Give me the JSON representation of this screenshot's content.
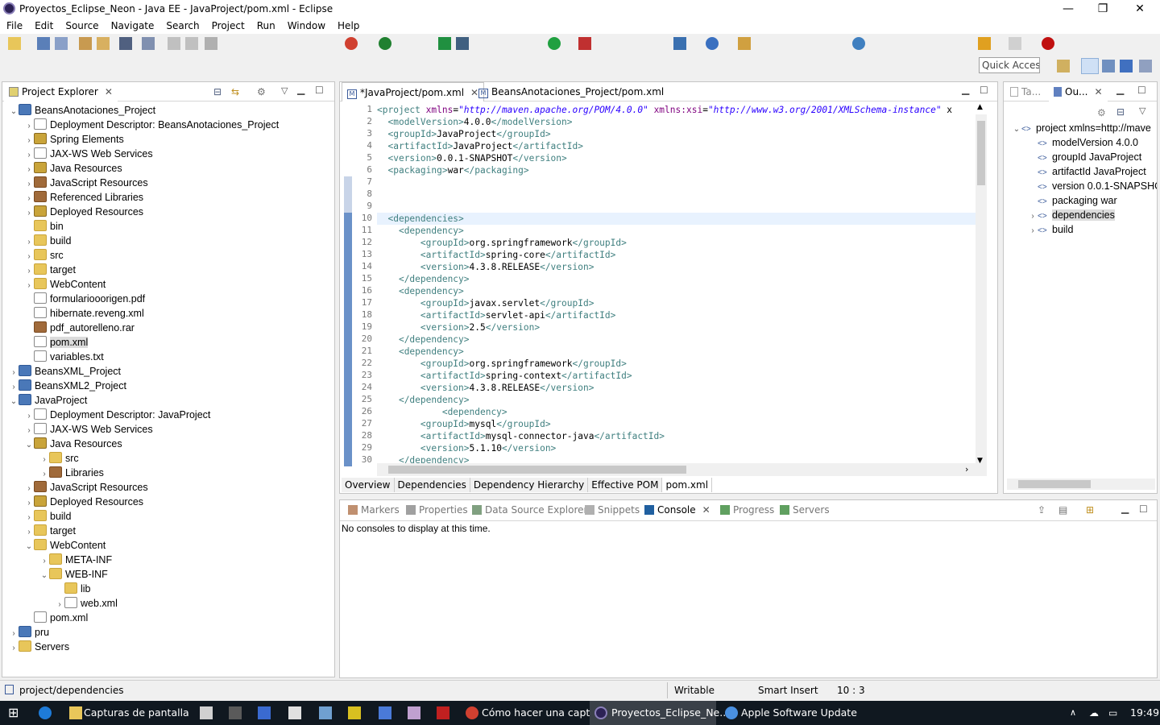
{
  "window": {
    "title": "Proyectos_Eclipse_Neon - Java EE - JavaProject/pom.xml - Eclipse",
    "minimize": "—",
    "restore": "❐",
    "close": "✕"
  },
  "menu": [
    "File",
    "Edit",
    "Source",
    "Navigate",
    "Search",
    "Project",
    "Run",
    "Window",
    "Help"
  ],
  "quick_access": "Quick Access",
  "explorer": {
    "tab": "Project Explorer",
    "items": [
      {
        "label": "BeansAnotaciones_Project",
        "level": 0,
        "exp": "open",
        "icon": "proj"
      },
      {
        "label": "Deployment Descriptor: BeansAnotaciones_Project",
        "level": 1,
        "exp": "closed",
        "icon": "file"
      },
      {
        "label": "Spring Elements",
        "level": 1,
        "exp": "closed",
        "icon": "jres"
      },
      {
        "label": "JAX-WS Web Services",
        "level": 1,
        "exp": "closed",
        "icon": "file"
      },
      {
        "label": "Java Resources",
        "level": 1,
        "exp": "closed",
        "icon": "jres"
      },
      {
        "label": "JavaScript Resources",
        "level": 1,
        "exp": "closed",
        "icon": "lib"
      },
      {
        "label": "Referenced Libraries",
        "level": 1,
        "exp": "closed",
        "icon": "lib"
      },
      {
        "label": "Deployed Resources",
        "level": 1,
        "exp": "closed",
        "icon": "jres"
      },
      {
        "label": "bin",
        "level": 1,
        "exp": "none",
        "icon": "folder"
      },
      {
        "label": "build",
        "level": 1,
        "exp": "closed",
        "icon": "folder"
      },
      {
        "label": "src",
        "level": 1,
        "exp": "closed",
        "icon": "folder"
      },
      {
        "label": "target",
        "level": 1,
        "exp": "closed",
        "icon": "folder"
      },
      {
        "label": "WebContent",
        "level": 1,
        "exp": "closed",
        "icon": "folder"
      },
      {
        "label": "formulariooorigen.pdf",
        "level": 1,
        "exp": "none",
        "icon": "file"
      },
      {
        "label": "hibernate.reveng.xml",
        "level": 1,
        "exp": "none",
        "icon": "file"
      },
      {
        "label": "pdf_autorelleno.rar",
        "level": 1,
        "exp": "none",
        "icon": "lib"
      },
      {
        "label": "pom.xml",
        "level": 1,
        "exp": "none",
        "icon": "file",
        "selected": true
      },
      {
        "label": "variables.txt",
        "level": 1,
        "exp": "none",
        "icon": "file"
      },
      {
        "label": "BeansXML_Project",
        "level": 0,
        "exp": "closed",
        "icon": "proj"
      },
      {
        "label": "BeansXML2_Project",
        "level": 0,
        "exp": "closed",
        "icon": "proj"
      },
      {
        "label": "JavaProject",
        "level": 0,
        "exp": "open",
        "icon": "proj"
      },
      {
        "label": "Deployment Descriptor: JavaProject",
        "level": 1,
        "exp": "closed",
        "icon": "file"
      },
      {
        "label": "JAX-WS Web Services",
        "level": 1,
        "exp": "closed",
        "icon": "file"
      },
      {
        "label": "Java Resources",
        "level": 1,
        "exp": "open",
        "icon": "jres"
      },
      {
        "label": "src",
        "level": 2,
        "exp": "closed",
        "icon": "folder"
      },
      {
        "label": "Libraries",
        "level": 2,
        "exp": "closed",
        "icon": "lib"
      },
      {
        "label": "JavaScript Resources",
        "level": 1,
        "exp": "closed",
        "icon": "lib"
      },
      {
        "label": "Deployed Resources",
        "level": 1,
        "exp": "closed",
        "icon": "jres"
      },
      {
        "label": "build",
        "level": 1,
        "exp": "closed",
        "icon": "folder"
      },
      {
        "label": "target",
        "level": 1,
        "exp": "closed",
        "icon": "folder"
      },
      {
        "label": "WebContent",
        "level": 1,
        "exp": "open",
        "icon": "folder"
      },
      {
        "label": "META-INF",
        "level": 2,
        "exp": "closed",
        "icon": "folder"
      },
      {
        "label": "WEB-INF",
        "level": 2,
        "exp": "open",
        "icon": "folder"
      },
      {
        "label": "lib",
        "level": 3,
        "exp": "none",
        "icon": "folder"
      },
      {
        "label": "web.xml",
        "level": 3,
        "exp": "closed",
        "icon": "file"
      },
      {
        "label": "pom.xml",
        "level": 1,
        "exp": "none",
        "icon": "file"
      },
      {
        "label": "pru",
        "level": 0,
        "exp": "closed",
        "icon": "proj"
      },
      {
        "label": "Servers",
        "level": 0,
        "exp": "closed",
        "icon": "folder"
      }
    ]
  },
  "editor": {
    "tabs": [
      "*JavaProject/pom.xml",
      "BeansAnotaciones_Project/pom.xml"
    ],
    "lines": [
      [
        [
          "tag",
          "<project "
        ],
        [
          "attr",
          "xmlns"
        ],
        [
          "txt",
          "="
        ],
        [
          "val",
          "\"http://maven.apache.org/POM/4.0.0\""
        ],
        [
          "txt",
          " "
        ],
        [
          "attr",
          "xmlns:xsi"
        ],
        [
          "txt",
          "="
        ],
        [
          "val",
          "\"http://www.w3.org/2001/XMLSchema-instance\""
        ],
        [
          "txt",
          " x"
        ]
      ],
      [
        [
          "txt",
          "  "
        ],
        [
          "tag",
          "<modelVersion>"
        ],
        [
          "txt",
          "4.0.0"
        ],
        [
          "tag",
          "</modelVersion>"
        ]
      ],
      [
        [
          "txt",
          "  "
        ],
        [
          "tag",
          "<groupId>"
        ],
        [
          "txt",
          "JavaProject"
        ],
        [
          "tag",
          "</groupId>"
        ]
      ],
      [
        [
          "txt",
          "  "
        ],
        [
          "tag",
          "<artifactId>"
        ],
        [
          "txt",
          "JavaProject"
        ],
        [
          "tag",
          "</artifactId>"
        ]
      ],
      [
        [
          "txt",
          "  "
        ],
        [
          "tag",
          "<version>"
        ],
        [
          "txt",
          "0.0.1-SNAPSHOT"
        ],
        [
          "tag",
          "</version>"
        ]
      ],
      [
        [
          "txt",
          "  "
        ],
        [
          "tag",
          "<packaging>"
        ],
        [
          "txt",
          "war"
        ],
        [
          "tag",
          "</packaging>"
        ]
      ],
      [],
      [],
      [],
      [
        [
          "txt",
          "  "
        ],
        [
          "tag",
          "<dependencies>"
        ]
      ],
      [
        [
          "txt",
          "    "
        ],
        [
          "tag",
          "<dependency>"
        ]
      ],
      [
        [
          "txt",
          "        "
        ],
        [
          "tag",
          "<groupId>"
        ],
        [
          "txt",
          "org.springframework"
        ],
        [
          "tag",
          "</groupId>"
        ]
      ],
      [
        [
          "txt",
          "        "
        ],
        [
          "tag",
          "<artifactId>"
        ],
        [
          "txt",
          "spring-core"
        ],
        [
          "tag",
          "</artifactId>"
        ]
      ],
      [
        [
          "txt",
          "        "
        ],
        [
          "tag",
          "<version>"
        ],
        [
          "txt",
          "4.3.8.RELEASE"
        ],
        [
          "tag",
          "</version>"
        ]
      ],
      [
        [
          "txt",
          "    "
        ],
        [
          "tag",
          "</dependency>"
        ]
      ],
      [
        [
          "txt",
          "    "
        ],
        [
          "tag",
          "<dependency>"
        ]
      ],
      [
        [
          "txt",
          "        "
        ],
        [
          "tag",
          "<groupId>"
        ],
        [
          "txt",
          "javax.servlet"
        ],
        [
          "tag",
          "</groupId>"
        ]
      ],
      [
        [
          "txt",
          "        "
        ],
        [
          "tag",
          "<artifactId>"
        ],
        [
          "txt",
          "servlet-api"
        ],
        [
          "tag",
          "</artifactId>"
        ]
      ],
      [
        [
          "txt",
          "        "
        ],
        [
          "tag",
          "<version>"
        ],
        [
          "txt",
          "2.5"
        ],
        [
          "tag",
          "</version>"
        ]
      ],
      [
        [
          "txt",
          "    "
        ],
        [
          "tag",
          "</dependency>"
        ]
      ],
      [
        [
          "txt",
          "    "
        ],
        [
          "tag",
          "<dependency>"
        ]
      ],
      [
        [
          "txt",
          "        "
        ],
        [
          "tag",
          "<groupId>"
        ],
        [
          "txt",
          "org.springframework"
        ],
        [
          "tag",
          "</groupId>"
        ]
      ],
      [
        [
          "txt",
          "        "
        ],
        [
          "tag",
          "<artifactId>"
        ],
        [
          "txt",
          "spring-context"
        ],
        [
          "tag",
          "</artifactId>"
        ]
      ],
      [
        [
          "txt",
          "        "
        ],
        [
          "tag",
          "<version>"
        ],
        [
          "txt",
          "4.3.8.RELEASE"
        ],
        [
          "tag",
          "</version>"
        ]
      ],
      [
        [
          "txt",
          "    "
        ],
        [
          "tag",
          "</dependency>"
        ]
      ],
      [
        [
          "txt",
          "            "
        ],
        [
          "tag",
          "<dependency>"
        ]
      ],
      [
        [
          "txt",
          "        "
        ],
        [
          "tag",
          "<groupId>"
        ],
        [
          "txt",
          "mysql"
        ],
        [
          "tag",
          "</groupId>"
        ]
      ],
      [
        [
          "txt",
          "        "
        ],
        [
          "tag",
          "<artifactId>"
        ],
        [
          "txt",
          "mysql-connector-java"
        ],
        [
          "tag",
          "</artifactId>"
        ]
      ],
      [
        [
          "txt",
          "        "
        ],
        [
          "tag",
          "<version>"
        ],
        [
          "txt",
          "5.1.10"
        ],
        [
          "tag",
          "</version>"
        ]
      ],
      [
        [
          "txt",
          "    "
        ],
        [
          "tag",
          "</dependency>"
        ]
      ]
    ],
    "pom_tabs": [
      "Overview",
      "Dependencies",
      "Dependency Hierarchy",
      "Effective POM",
      "pom.xml"
    ]
  },
  "outline": {
    "tabs": [
      "Ta...",
      "Ou..."
    ],
    "items": [
      {
        "label": "project xmlns=http://mave",
        "level": 0,
        "exp": "open"
      },
      {
        "label": "modelVersion  4.0.0",
        "level": 1,
        "exp": "none"
      },
      {
        "label": "groupId  JavaProject",
        "level": 1,
        "exp": "none"
      },
      {
        "label": "artifactId  JavaProject",
        "level": 1,
        "exp": "none"
      },
      {
        "label": "version  0.0.1-SNAPSHO",
        "level": 1,
        "exp": "none"
      },
      {
        "label": "packaging  war",
        "level": 1,
        "exp": "none"
      },
      {
        "label": "dependencies",
        "level": 1,
        "exp": "closed",
        "selected": true
      },
      {
        "label": "build",
        "level": 1,
        "exp": "closed"
      }
    ]
  },
  "bottom": {
    "tabs": [
      "Markers",
      "Properties",
      "Data Source Explorer",
      "Snippets",
      "Console",
      "Progress",
      "Servers"
    ],
    "message": "No consoles to display at this time."
  },
  "status": {
    "path": "project/dependencies",
    "writable": "Writable",
    "insert": "Smart Insert",
    "position": "10 : 3"
  },
  "taskbar": {
    "items": [
      "Capturas de pantalla",
      "Cómo hacer una capt...",
      "Proyectos_Eclipse_Ne...",
      "Apple Software Update"
    ],
    "time": "19:49"
  }
}
